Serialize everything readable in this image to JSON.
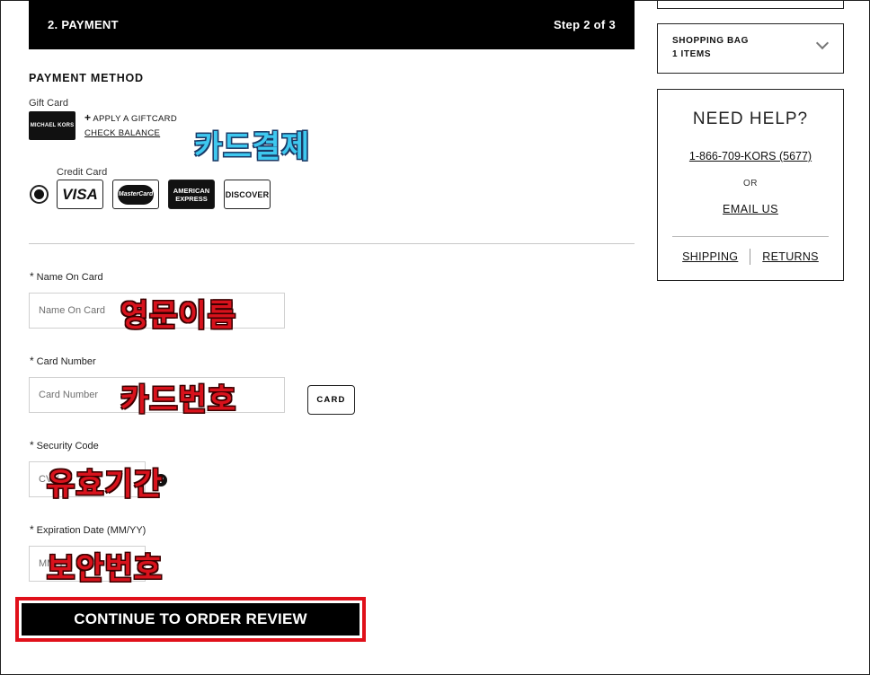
{
  "step": {
    "title": "2. PAYMENT",
    "progress": "Step 2 of 3"
  },
  "payment": {
    "section_title": "PAYMENT METHOD",
    "gift_card": {
      "label": "Gift Card",
      "logo_text": "MICHAEL KORS",
      "apply_label": "APPLY A GIFTCARD",
      "check_balance_label": "CHECK BALANCE"
    },
    "credit_card": {
      "label": "Credit Card",
      "selected": true,
      "logos": [
        "VISA",
        "MasterCard",
        "AMERICAN EXPRESS",
        "DISCOVER"
      ]
    }
  },
  "annotations": {
    "card_payment": "카드결제",
    "english_name": "영문이름",
    "card_number": "카드번호",
    "expiry": "유효기간",
    "security": "보안번호"
  },
  "form": {
    "name_on_card": {
      "label": "Name On Card",
      "placeholder": "Name On Card",
      "required_mark": "*"
    },
    "card_number": {
      "label": "Card Number",
      "placeholder": "Card Number",
      "required_mark": "*",
      "card_button": "CARD"
    },
    "security_code": {
      "label": "Security Code",
      "placeholder": "CVV",
      "required_mark": "*",
      "help_icon": "?"
    },
    "expiration_date": {
      "label": "Expiration Date (MM/YY)",
      "placeholder": "MM/YY",
      "required_mark": "*"
    }
  },
  "continue_button": "CONTINUE TO ORDER REVIEW",
  "sidebar": {
    "shopping_bag": {
      "title": "SHOPPING BAG",
      "items": "1 ITEMS"
    },
    "help": {
      "title": "NEED HELP?",
      "phone": "1-866-709-KORS (5677)",
      "or": "OR",
      "email": "EMAIL US",
      "links": [
        "SHIPPING",
        "RETURNS"
      ]
    }
  },
  "colors": {
    "black": "#000000",
    "highlight_red": "#e0101a",
    "annotation_red": "#d8121c",
    "annotation_blue": "#3ec8ef"
  }
}
